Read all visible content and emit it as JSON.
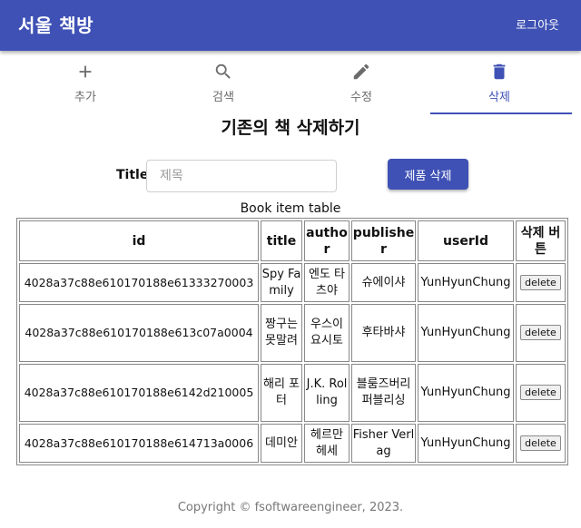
{
  "appbar": {
    "title": "서울 책방",
    "logout_label": "로그아웃",
    "color": "#3f51b5"
  },
  "tabs": [
    {
      "label": "추가",
      "icon": "plus-icon"
    },
    {
      "label": "검색",
      "icon": "search-icon"
    },
    {
      "label": "수정",
      "icon": "pencil-icon"
    },
    {
      "label": "삭제",
      "icon": "trash-icon",
      "active": true
    }
  ],
  "page": {
    "heading": "기존의 책 삭제하기"
  },
  "form": {
    "title_label": "Title",
    "title_placeholder": "제목",
    "title_value": "",
    "delete_button": "제품 삭제"
  },
  "table": {
    "caption": "Book item table",
    "headers": [
      "id",
      "title",
      "author",
      "publisher",
      "userId",
      "삭제 버튼"
    ],
    "delete_label": "delete",
    "rows": [
      {
        "id": "4028a37c88e610170188e61333270003",
        "title": "Spy Family",
        "author": "엔도 타츠야",
        "publisher": "슈에이샤",
        "userId": "YunHyunChung"
      },
      {
        "id": "4028a37c88e610170188e613c07a0004",
        "title": "짱구는 못말려",
        "author": "우스이 요시토",
        "publisher": "후타바샤",
        "userId": "YunHyunChung"
      },
      {
        "id": "4028a37c88e610170188e6142d210005",
        "title": "해리 포터",
        "author": "J.K. Rolling",
        "publisher": "블룸즈버리 퍼블리싱",
        "userId": "YunHyunChung"
      },
      {
        "id": "4028a37c88e610170188e614713a0006",
        "title": "데미안",
        "author": "헤르만 헤세",
        "publisher": "Fisher Verlag",
        "userId": "YunHyunChung"
      }
    ]
  },
  "footer": {
    "copyright": "Copyright © fsoftwareengineer, 2023."
  }
}
